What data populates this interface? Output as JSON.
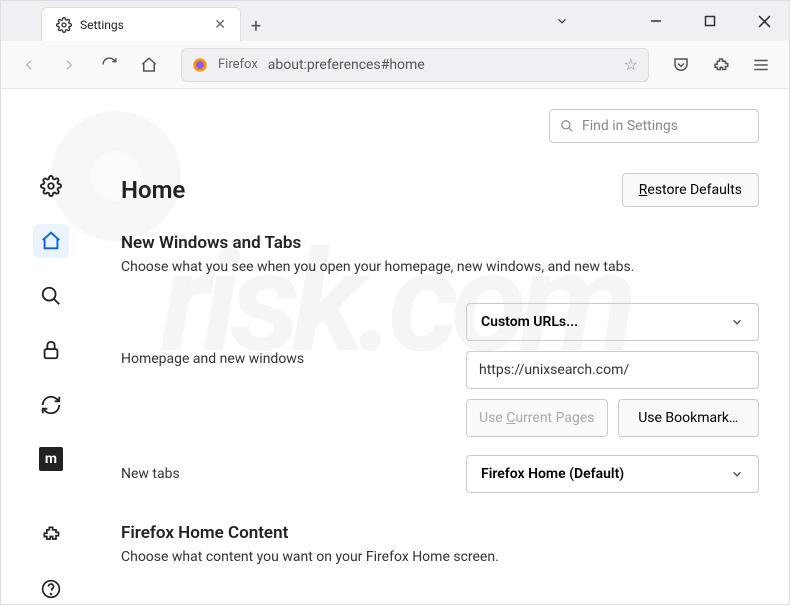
{
  "tab": {
    "title": "Settings"
  },
  "url_bar": {
    "label": "Firefox",
    "url": "about:preferences#home"
  },
  "search": {
    "placeholder": "Find in Settings"
  },
  "page": {
    "title": "Home",
    "restore": "estore Defaults",
    "section1": {
      "heading": "New Windows and Tabs",
      "desc": "Choose what you see when you open your homepage, new windows, and new tabs."
    },
    "homepage": {
      "label": "Homepage and new windows",
      "select": "Custom URLs...",
      "value": "https://unixsearch.com/",
      "use_current": "urrent Pages",
      "use_bookmark": "Use Bookmark…"
    },
    "newtabs": {
      "label": "New tabs",
      "select": "Firefox Home (Default)"
    },
    "section2": {
      "heading": "Firefox Home Content",
      "desc": "Choose what content you want on your Firefox Home screen."
    }
  }
}
